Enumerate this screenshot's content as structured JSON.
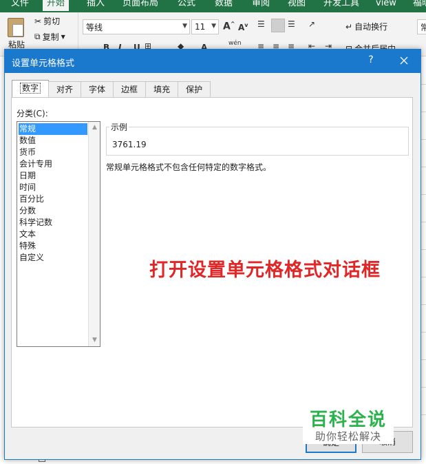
{
  "ribbon": {
    "menu_tabs": [
      "文件",
      "开始",
      "插入",
      "页面布局",
      "公式",
      "数据",
      "审阅",
      "视图",
      "开发工具",
      "view",
      "福昕"
    ],
    "active_tab": "开始",
    "paste": "粘贴",
    "cut": "剪切",
    "copy": "复制",
    "font_name": "等线",
    "font_size": "11",
    "wrap_text": "自动换行",
    "merge_center": "合并后居中",
    "right_partial": "常"
  },
  "dialog": {
    "title": "设置单元格格式",
    "help": "?",
    "tabs": [
      "数字",
      "对齐",
      "字体",
      "边框",
      "填充",
      "保护"
    ],
    "active_tab_index": 0,
    "category_label": "分类(C):",
    "categories": [
      "常规",
      "数值",
      "货币",
      "会计专用",
      "日期",
      "时间",
      "百分比",
      "分数",
      "科学记数",
      "文本",
      "特殊",
      "自定义"
    ],
    "selected_category_index": 0,
    "sample_legend": "示例",
    "sample_value": "3761.19",
    "description": "常规单元格格式不包含任何特定的数字格式。",
    "ok_label": "确定",
    "cancel_label": "取消"
  },
  "annotation": "打开设置单元格格式对话框",
  "watermark": {
    "main": "百科全说",
    "sub": "助你轻松解决"
  },
  "colors": {
    "excel_green": "#217346",
    "title_blue": "#1a79cd",
    "selection_blue": "#3399ff",
    "annotation_red": "#e02626",
    "watermark_green": "#2bb24c"
  }
}
